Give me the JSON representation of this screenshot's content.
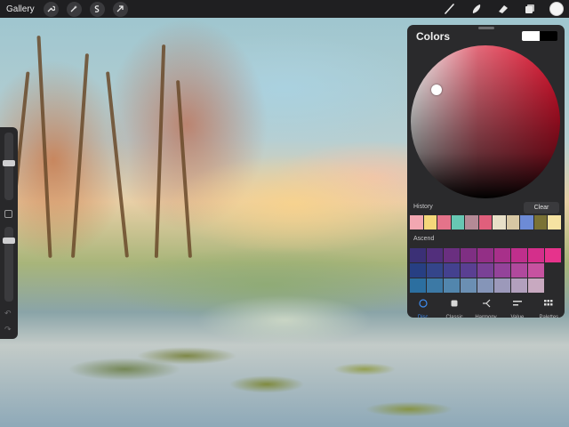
{
  "topbar": {
    "gallery_label": "Gallery",
    "left_tools": [
      "wrench-icon",
      "magic-wand-icon",
      "selection-s-icon",
      "transform-arrow-icon"
    ],
    "right_tools": [
      "brush-icon",
      "smudge-icon",
      "eraser-icon",
      "layers-icon"
    ],
    "current_color": "#f4f4f4"
  },
  "sidebar": {
    "brush_size_level": 0.55,
    "opacity_level": 0.15,
    "undo_icon": "undo-icon",
    "redo_icon": "redo-icon"
  },
  "colors_panel": {
    "title": "Colors",
    "primary_swatch": "#ffffff",
    "secondary_swatch": "#000000",
    "history_label": "History",
    "clear_label": "Clear",
    "history_colors": [
      "#f2a7b1",
      "#f4d77a",
      "#e4738a",
      "#67c7b3",
      "#b48a96",
      "#e05f7c",
      "#e8e0c8",
      "#d7c7a3",
      "#6d8bd6",
      "#7a7235",
      "#f6e3a2"
    ],
    "palette_label": "Ascend",
    "palette_rows": [
      [
        "#3b3076",
        "#522f7c",
        "#6a2f80",
        "#7f2f83",
        "#932f86",
        "#a8308a",
        "#bf2f8c",
        "#d42f8b",
        "#e6338c"
      ],
      [
        "#273f83",
        "#34458a",
        "#44418f",
        "#5a3f92",
        "#7a4196",
        "#94439a",
        "#b0499d",
        "#c752a0",
        "#2a2a2c"
      ],
      [
        "#2c6fa0",
        "#3c79a5",
        "#5286ad",
        "#6b8fb3",
        "#8595b8",
        "#9c99ba",
        "#b2a0bd",
        "#c8a9c0",
        "#2a2a2c"
      ]
    ],
    "tabs": [
      {
        "label": "Disc",
        "icon": "disc-icon",
        "active": true
      },
      {
        "label": "Classic",
        "icon": "classic-square-icon",
        "active": false
      },
      {
        "label": "Harmony",
        "icon": "harmony-icon",
        "active": false
      },
      {
        "label": "Value",
        "icon": "value-sliders-icon",
        "active": false
      },
      {
        "label": "Palettes",
        "icon": "palettes-grid-icon",
        "active": false
      }
    ]
  }
}
